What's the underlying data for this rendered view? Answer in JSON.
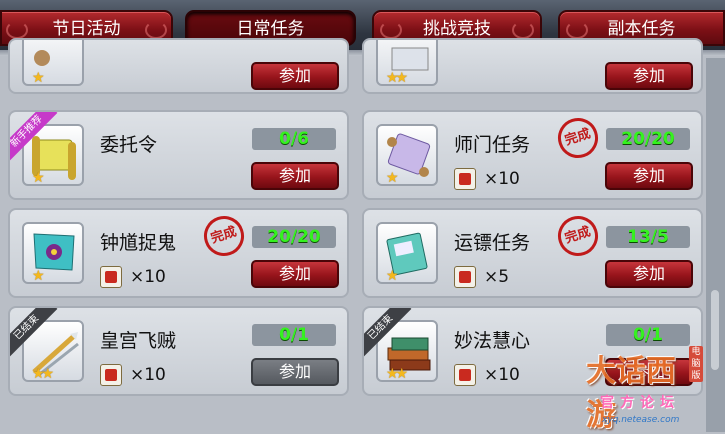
{
  "tabs": [
    {
      "label": "节日活动",
      "active": false
    },
    {
      "label": "日常任务",
      "active": true
    },
    {
      "label": "挑战竞技",
      "active": false
    },
    {
      "label": "副本任务",
      "active": false
    }
  ],
  "top_partial": {
    "left_button": "参加",
    "right_button": "参加"
  },
  "tasks": [
    {
      "name": "委托令",
      "progress": "0/6",
      "button": "参加",
      "ribbon": "新手推荐",
      "stars": 1,
      "reward_qty": "",
      "completed": false
    },
    {
      "name": "师门任务",
      "progress": "20/20",
      "button": "参加",
      "ribbon": "",
      "stars": 1,
      "reward_qty": "×10",
      "completed": true,
      "stamp": "完成"
    },
    {
      "name": "钟馗捉鬼",
      "progress": "20/20",
      "button": "参加",
      "ribbon": "",
      "stars": 1,
      "reward_qty": "×10",
      "completed": true,
      "stamp": "完成"
    },
    {
      "name": "运镖任务",
      "progress": "13/5",
      "button": "参加",
      "ribbon": "",
      "stars": 1,
      "reward_qty": "×5",
      "completed": true,
      "stamp": "完成"
    },
    {
      "name": "皇宫飞贼",
      "progress": "0/1",
      "button": "参加",
      "ribbon": "已结束",
      "stars": 2,
      "reward_qty": "×10",
      "completed": false,
      "disabled": true
    },
    {
      "name": "妙法慧心",
      "progress": "0/1",
      "button": "参加",
      "ribbon": "已结束",
      "stars": 2,
      "reward_qty": "×10",
      "completed": false
    }
  ],
  "watermark": {
    "logo": "大话西游",
    "sub": "官方论坛",
    "url": "xyq.netease.com",
    "tag": "电脑版"
  },
  "colors": {
    "accent_red": "#97141b",
    "progress_green": "#35f21f",
    "stamp_red": "#c01a1a"
  }
}
